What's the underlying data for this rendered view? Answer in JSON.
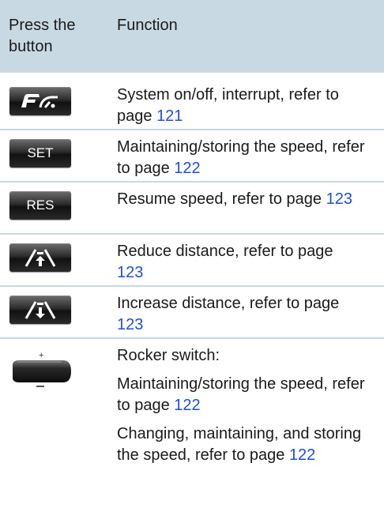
{
  "header": {
    "col1": "Press the button",
    "col2": "Function"
  },
  "rows": [
    {
      "icon": "cruise-system-icon",
      "label": "",
      "text": "System on/off, interrupt, refer to page ",
      "page": "121"
    },
    {
      "icon": "set-button",
      "label": "SET",
      "text": "Maintaining/storing the speed, refer to page ",
      "page": "122"
    },
    {
      "icon": "res-button",
      "label": "RES",
      "text": "Resume speed, refer to page ",
      "page": "123"
    },
    {
      "icon": "reduce-distance-icon",
      "label": "",
      "text": "Reduce distance, refer to page ",
      "page": "123"
    },
    {
      "icon": "increase-distance-icon",
      "label": "",
      "text": "Increase distance, refer to page ",
      "page": "123"
    }
  ],
  "rocker": {
    "title": "Rocker switch:",
    "items": [
      {
        "text": "Maintaining/storing the speed, refer to page ",
        "page": "122"
      },
      {
        "text": "Changing, maintaining, and storing the speed, refer to page ",
        "page": "122"
      }
    ]
  }
}
